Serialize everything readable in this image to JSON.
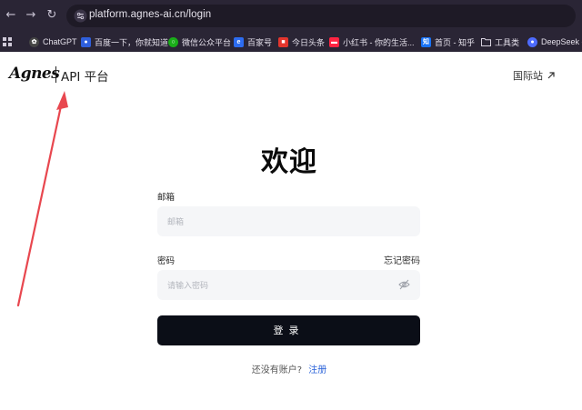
{
  "browser": {
    "url": "platform.agnes-ai.cn/login",
    "bookmarks": [
      {
        "label": "ChatGPT",
        "icon": "chatgpt-icon"
      },
      {
        "label": "百度一下，你就知道",
        "icon": "baidu-icon"
      },
      {
        "label": "微信公众平台",
        "icon": "wechat-mp-icon"
      },
      {
        "label": "百家号",
        "icon": "baijiahao-icon"
      },
      {
        "label": "今日头条",
        "icon": "toutiao-icon"
      },
      {
        "label": "小红书 - 你的生活...",
        "icon": "xiaohongshu-icon"
      },
      {
        "label": "首页 - 知乎",
        "icon": "zhihu-icon"
      },
      {
        "label": "工具类",
        "icon": "folder-icon"
      },
      {
        "label": "DeepSeek -",
        "icon": "deepseek-icon"
      }
    ]
  },
  "header": {
    "logo_text": "Agnes",
    "product": "API 平台",
    "intl_link": "国际站"
  },
  "form": {
    "title": "欢迎",
    "email_label": "邮箱",
    "email_placeholder": "邮箱",
    "password_label": "密码",
    "forgot_link": "忘记密码",
    "password_placeholder": "请输入密码",
    "login_button": "登录",
    "no_account_text": "还没有账户?",
    "signup_link": "注册"
  },
  "colors": {
    "accent_link": "#2b63d9",
    "button_bg": "#0b0e17",
    "annotation_arrow": "#e8474f"
  }
}
